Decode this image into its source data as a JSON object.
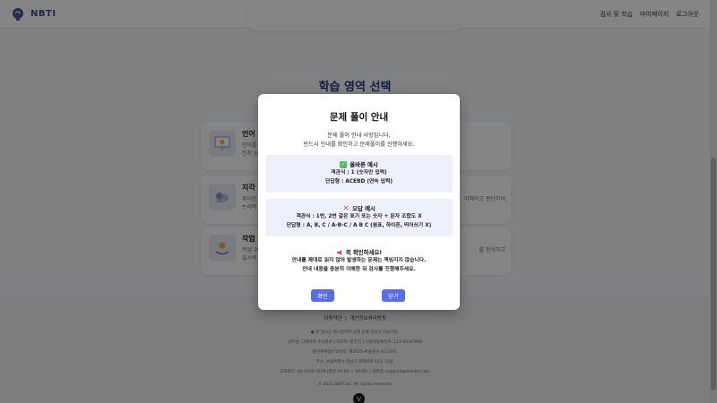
{
  "header": {
    "logo_text": "NBTI",
    "nav": [
      "검사 및 학습",
      "마이페이지",
      "로그아웃"
    ]
  },
  "page": {
    "section_title": "학습 영역 선택",
    "areas": [
      {
        "title": "언어",
        "desc_left": "언어를",
        "desc_left2": "인지 능",
        "desc_right": ""
      },
      {
        "title": "지각",
        "desc_left": "주어진",
        "desc_left2": "논리적",
        "desc_right": "이해하고 판단하여"
      },
      {
        "title": "작업",
        "desc_left": "작업 수",
        "desc_left2": "일시적",
        "desc_right": "를 인식하고"
      }
    ]
  },
  "footer": {
    "links": [
      "이용약관",
      "|",
      "개인정보처리방침"
    ],
    "notice": "● 본 정보는 예시용이며 실제 등록 정보가 아닙니다.",
    "company": "상호명: 디패어로 주식회사 | 대표자: 정진건 | 사업자등록번호: 123-45-67890",
    "mail_order": "통신판매업신고번호: 제2025-서울강남-01234호",
    "address": "주소: 서울특별시 강남구 테헤란로 123, 10층",
    "contact": "고객센터: 02-1234-5678 (평일 09:00 ~ 18:00) | 이메일: support@dasnbti.com",
    "copyright": "© 2025 NBTI Inc. All rights reserved.",
    "fab_label": "V"
  },
  "modal": {
    "title": "문제 풀이 안내",
    "intro_1": "문제 풀이 안내 사항입니다.",
    "intro_2": "반드시 안내를 확인하고 문제풀이를 진행하세요.",
    "correct": {
      "heading": "올바른 예시",
      "line_1": "객관식 : 1 (숫자만 입력)",
      "line_2": "단답형 : ACEBD (연속 입력)"
    },
    "wrong": {
      "heading": "오답 예시",
      "line_1": "객관식 : 1번, 2번 같은 표기 또는 숫자 + 문자 조합도 X",
      "line_2": "단답형 : A, B, C / A-B-C / A B C (쉼표, 하이픈, 띄어쓰기 X)"
    },
    "warning": {
      "heading": "꼭 확인하세요!",
      "line_1": "안내를 제대로 읽지 않아 발생하는 문제는 책임지지 않습니다.",
      "line_2": "안내 내용을 충분히 이해한 뒤 검사를 진행해주세요."
    },
    "confirm_label": "확인",
    "close_label": "닫기"
  }
}
